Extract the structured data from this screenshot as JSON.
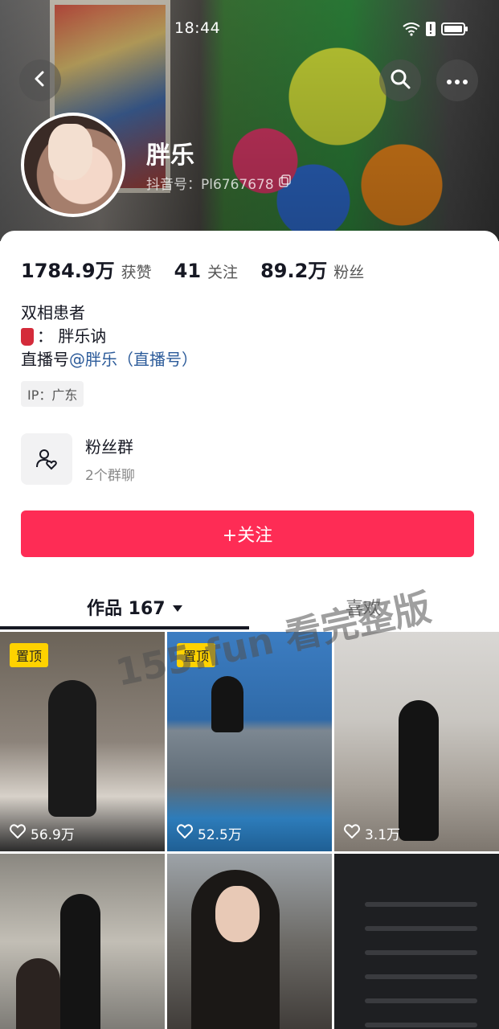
{
  "status_bar": {
    "time": "18:44"
  },
  "profile": {
    "name": "胖乐",
    "douyin_id": "抖音号：Pl6767678"
  },
  "stats": [
    {
      "value": "1784.9万",
      "label": "获赞"
    },
    {
      "value": "41",
      "label": "关注"
    },
    {
      "value": "89.2万",
      "label": "粉丝"
    }
  ],
  "bio": {
    "line1": "双相患者",
    "line2": "：  胖乐讷",
    "line3_prefix": "直播号",
    "line3_mention": "@胖乐（直播号）"
  },
  "ip_tag": "IP：广东",
  "fan_group": {
    "title": "粉丝群",
    "subtitle": "2个群聊"
  },
  "follow_button": "+关注",
  "tabs": {
    "works": "作品 167",
    "likes": "喜欢"
  },
  "watermark": "155.fun 看完整版",
  "videos": [
    {
      "pinned": "置顶",
      "likes": "56.9万"
    },
    {
      "pinned": "置顶",
      "likes": "52.5万"
    },
    {
      "pinned": "",
      "likes": "3.1万"
    },
    {
      "pinned": "",
      "likes": ""
    },
    {
      "pinned": "",
      "likes": ""
    },
    {
      "pinned": "",
      "likes": ""
    }
  ],
  "icons": {
    "back": "chevron-left-icon",
    "search": "search-icon",
    "more": "more-icon",
    "copy": "copy-icon",
    "fan_group": "group-heart-icon",
    "heart": "heart-icon",
    "dropdown": "caret-down-icon"
  },
  "colors": {
    "accent": "#fe2c55",
    "mention": "#2c5b9a",
    "pin": "#ffd200"
  }
}
